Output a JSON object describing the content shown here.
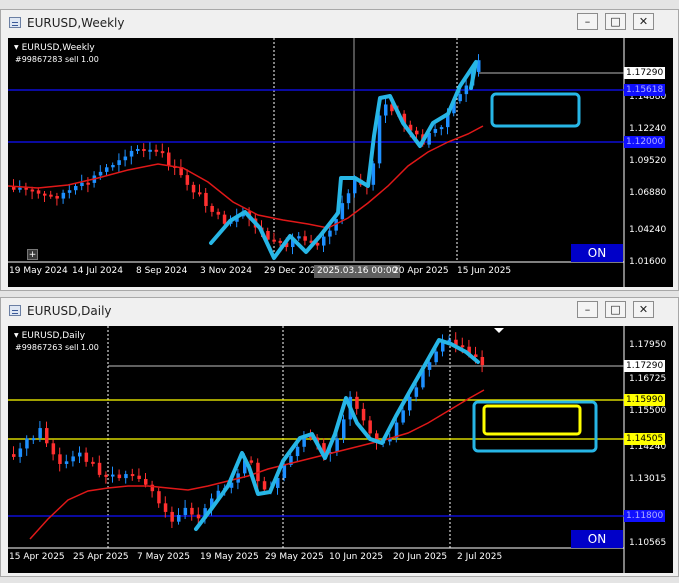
{
  "weekly": {
    "window_title": "EURUSD,Weekly",
    "symbol_label": "EURUSD,Weekly",
    "order_label": "#99867283 sell 1.00",
    "axis_prices": [
      "1.17290",
      "1.14880",
      "1.12240",
      "1.09520",
      "1.06880",
      "1.04240",
      "1.01600"
    ],
    "tag_last": "1.17290",
    "tag_blue_1": "1.15618",
    "tag_blue_2": "1.12000",
    "dates": [
      "19 May 2024",
      "14 Jul 2024",
      "8 Sep 2024",
      "3 Nov 2024",
      "29 Dec 2024",
      "2025.03.16 00:00",
      "20 Apr 2025",
      "15 Jun 2025"
    ],
    "on_button": "ON",
    "plus_button": "+"
  },
  "daily": {
    "window_title": "EURUSD,Daily",
    "symbol_label": "EURUSD,Daily",
    "order_label": "#99867263 sell 1.00",
    "axis_prices": [
      "1.17950",
      "1.16725",
      "1.15500",
      "1.14240",
      "1.13015",
      "1.11790",
      "1.10565"
    ],
    "tag_last": "1.17290",
    "tag_yellow_1": "1.15990",
    "tag_yellow_2": "1.14505",
    "tag_blue": "1.11800",
    "dates": [
      "15 Apr 2025",
      "25 Apr 2025",
      "7 May 2025",
      "19 May 2025",
      "29 May 2025",
      "10 Jun 2025",
      "20 Jun 2025",
      "2 Jul 2025"
    ],
    "on_button": "ON"
  },
  "window_buttons": {
    "minimize": "–",
    "maximize": "□",
    "close": "✕"
  },
  "colors": {
    "background": "#000000",
    "bull": "#1e90ff",
    "bear": "#ff3030",
    "ma": "#e01818",
    "hline_blue": "#1010ff",
    "hline_yellow": "#ffff00",
    "annotation": "#27b6e6"
  }
}
